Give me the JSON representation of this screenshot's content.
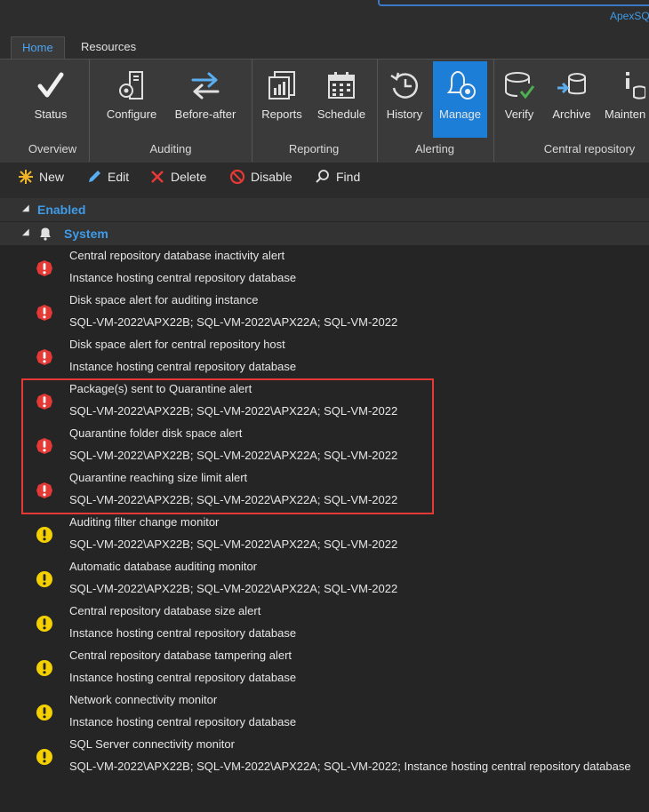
{
  "window": {
    "app_title": "ApexSQ"
  },
  "tabs": [
    {
      "label": "Home"
    },
    {
      "label": "Resources"
    }
  ],
  "ribbon": {
    "buttons": [
      {
        "label": "Status"
      },
      {
        "label": "Configure"
      },
      {
        "label": "Before-after"
      },
      {
        "label": "Reports"
      },
      {
        "label": "Schedule"
      },
      {
        "label": "History"
      },
      {
        "label": "Manage"
      },
      {
        "label": "Verify"
      },
      {
        "label": "Archive"
      },
      {
        "label": "Mainten"
      }
    ],
    "groups": [
      {
        "label": "Overview"
      },
      {
        "label": "Auditing"
      },
      {
        "label": "Reporting"
      },
      {
        "label": "Alerting"
      },
      {
        "label": "Central repository"
      }
    ]
  },
  "toolbar": {
    "new_label": "New",
    "edit_label": "Edit",
    "delete_label": "Delete",
    "disable_label": "Disable",
    "find_label": "Find"
  },
  "tree": {
    "enabled_label": "Enabled",
    "system_label": "System",
    "alerts": [
      {
        "name": "Central repository database inactivity alert",
        "target": "Instance hosting central repository database",
        "severity": "high"
      },
      {
        "name": "Disk space alert for auditing instance",
        "target": "SQL-VM-2022\\APX22B; SQL-VM-2022\\APX22A; SQL-VM-2022",
        "severity": "high"
      },
      {
        "name": "Disk space alert for central repository host",
        "target": "Instance hosting central repository database",
        "severity": "high"
      },
      {
        "name": "Package(s) sent to Quarantine alert",
        "target": "SQL-VM-2022\\APX22B; SQL-VM-2022\\APX22A; SQL-VM-2022",
        "severity": "high"
      },
      {
        "name": "Quarantine folder disk space alert",
        "target": "SQL-VM-2022\\APX22B; SQL-VM-2022\\APX22A; SQL-VM-2022",
        "severity": "high"
      },
      {
        "name": "Quarantine reaching size limit alert",
        "target": "SQL-VM-2022\\APX22B; SQL-VM-2022\\APX22A; SQL-VM-2022",
        "severity": "high"
      },
      {
        "name": "Auditing filter change monitor",
        "target": "SQL-VM-2022\\APX22B; SQL-VM-2022\\APX22A; SQL-VM-2022",
        "severity": "medium"
      },
      {
        "name": "Automatic database auditing monitor",
        "target": "SQL-VM-2022\\APX22B; SQL-VM-2022\\APX22A; SQL-VM-2022",
        "severity": "medium"
      },
      {
        "name": "Central repository database size alert",
        "target": "Instance hosting central repository database",
        "severity": "medium"
      },
      {
        "name": "Central repository database tampering alert",
        "target": "Instance hosting central repository database",
        "severity": "medium"
      },
      {
        "name": "Network connectivity monitor",
        "target": "Instance hosting central repository database",
        "severity": "medium"
      },
      {
        "name": "SQL Server connectivity monitor",
        "target": "SQL-VM-2022\\APX22B; SQL-VM-2022\\APX22A; SQL-VM-2022; Instance hosting central repository database",
        "severity": "medium"
      }
    ]
  },
  "colors": {
    "high": "#e53935",
    "medium": "#f5d000",
    "accent": "#1c7ed6",
    "link": "#3f9be8",
    "highlight_box": "#e53935"
  }
}
